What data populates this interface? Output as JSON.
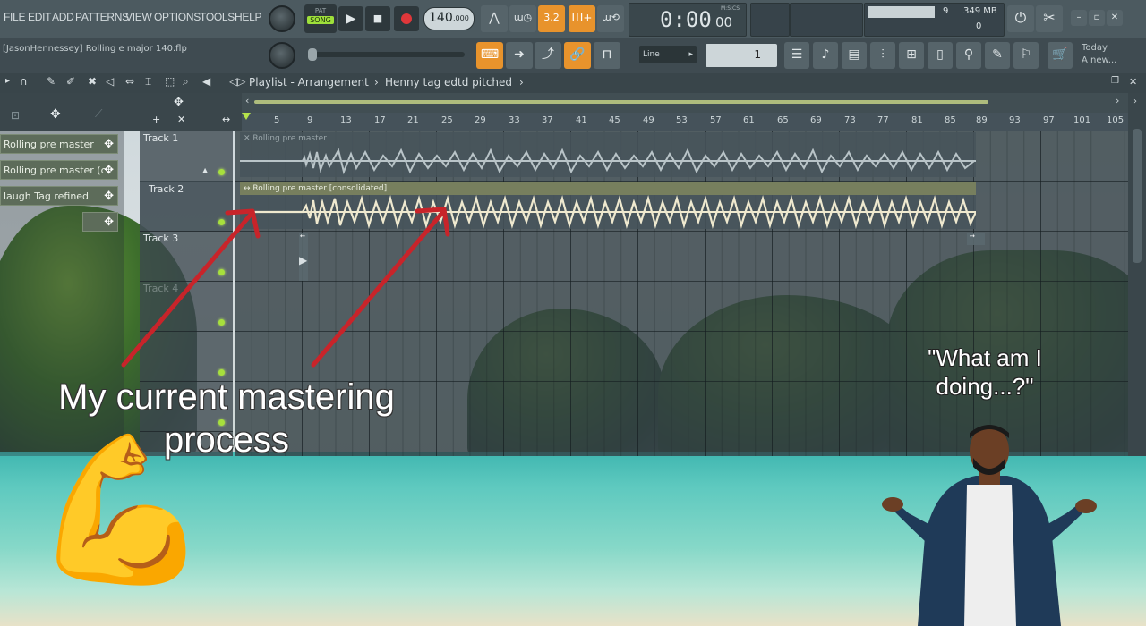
{
  "menu": {
    "items": [
      "FILE",
      "EDIT",
      "ADD",
      "PATTERNS",
      "VIEW",
      "OPTIONS",
      "TOOLS",
      "HELP"
    ]
  },
  "transport": {
    "mode_pat": "PAT",
    "mode_song": "SONG",
    "tempo": "140",
    "tempo_decimals": ".000",
    "time_display": "0:00",
    "time_ms": "00",
    "time_unit": "M:S:CS",
    "pattern_step": "3.2",
    "cpu_value": "9",
    "memory": "349 MB",
    "polyphony": "0"
  },
  "project": {
    "filename": "[JasonHennessey] Rolling e major 140.flp",
    "snap_mode": "Line",
    "pattern_number": "1",
    "news_label": "Today",
    "news_text": "A new..."
  },
  "playlist": {
    "title": "Playlist - Arrangement",
    "separator": "›",
    "pattern_name": "Henny tag edtd pitched",
    "ruler_ticks": [
      "5",
      "9",
      "13",
      "17",
      "21",
      "25",
      "29",
      "33",
      "37",
      "41",
      "45",
      "49",
      "53",
      "57",
      "61",
      "65",
      "69",
      "73",
      "77",
      "81",
      "85",
      "89",
      "93",
      "97",
      "101",
      "105"
    ],
    "tracks": [
      {
        "name": "Track 1"
      },
      {
        "name": "Track 2"
      },
      {
        "name": "Track 3"
      },
      {
        "name": "Track 4"
      }
    ],
    "clips": [
      {
        "label": "Rolling pre master"
      },
      {
        "label": "Rolling pre master [consolidated]"
      }
    ]
  },
  "pattern_picker": {
    "items": [
      {
        "label": "Rolling pre master"
      },
      {
        "label": "Rolling pre master (c"
      },
      {
        "label": "laugh Tag refined"
      },
      {
        "label": ""
      }
    ]
  },
  "meme": {
    "caption_main": "My current mastering process",
    "caption_quote": "\"What am I doing...?\"",
    "emoji": "💪"
  },
  "colors": {
    "arrow": "#c8242a",
    "accent_orange": "#e8932c",
    "track_led": "#a7e03c"
  }
}
